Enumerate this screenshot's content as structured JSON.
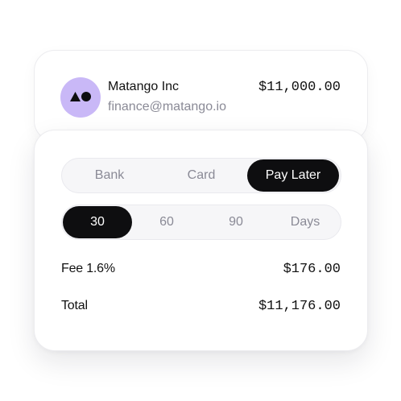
{
  "vendor": {
    "name": "Matango Inc",
    "email": "finance@matango.io",
    "amount": "$11,000.00",
    "avatar_icon": "triangle-circle-logo-icon",
    "avatar_color": "#c9b8f7"
  },
  "payment_methods": {
    "tabs": [
      {
        "label": "Bank",
        "active": false
      },
      {
        "label": "Card",
        "active": false
      },
      {
        "label": "Pay Later",
        "active": true
      }
    ]
  },
  "terms": {
    "options": [
      {
        "label": "30",
        "active": true
      },
      {
        "label": "60",
        "active": false
      },
      {
        "label": "90",
        "active": false
      },
      {
        "label": "Days",
        "active": false
      }
    ]
  },
  "summary": {
    "fee_label": "Fee 1.6%",
    "fee_value": "$176.00",
    "total_label": "Total",
    "total_value": "$11,176.00"
  },
  "colors": {
    "active_tab_bg": "#0e0e10",
    "inactive_text": "#8a8a96",
    "accent_avatar": "#c9b8f7"
  }
}
